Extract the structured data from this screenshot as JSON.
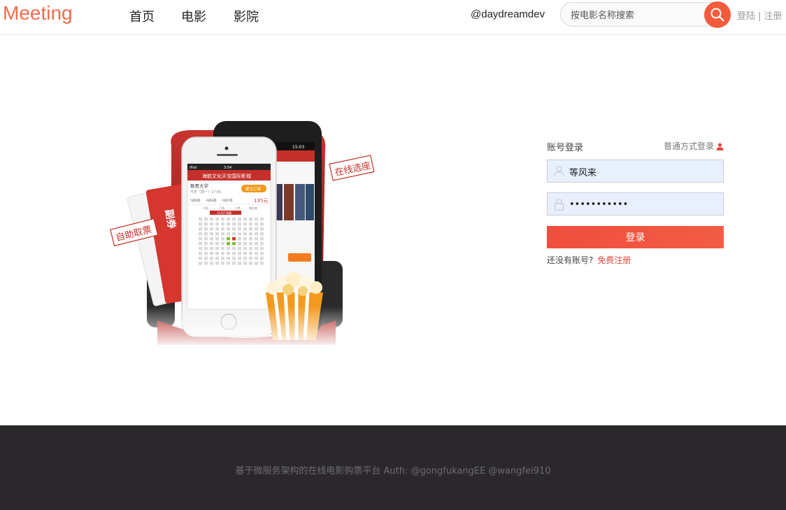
{
  "header": {
    "logo": "Meeting",
    "nav": [
      {
        "label": "首页"
      },
      {
        "label": "电影"
      },
      {
        "label": "影院"
      }
    ],
    "user_handle": "@daydreamdev",
    "search": {
      "placeholder": "按电影名称搜索",
      "icon": "search-icon"
    },
    "auth": {
      "login": "登陆",
      "separator": "|",
      "register": "注册"
    }
  },
  "illustration": {
    "tag_select_seat": "在线选座",
    "tag_pickup": "自助取票",
    "phone": {
      "carrier": "iPod",
      "time": "3:54",
      "cinema_name": "海航文化天宝国际影城",
      "movie": "致青大学",
      "showtime": "今天（周一）17:00",
      "submit_btn": "提交订单",
      "tabs": [
        "5排6座",
        "6排6座",
        "6排7座"
      ],
      "price": "135元",
      "legend": [
        "可选",
        "已选",
        "已售",
        "情侣座"
      ],
      "screen_label": "11号厅银幕"
    },
    "android": {
      "time": "15:03"
    }
  },
  "login": {
    "title": "账号登录",
    "alt_login": "普通方式登录",
    "username_value": "等风来",
    "password_value": "•••••••••••",
    "submit": "登录",
    "no_account": "还没有账号?",
    "register_link": "免费注册",
    "colors": {
      "accent": "#f04e3e",
      "field_bg": "#e8f0fe"
    }
  },
  "footer": {
    "text": "基于微服务架构的在线电影购票平台 Auth: @gongfukangEE @wangfei910"
  }
}
